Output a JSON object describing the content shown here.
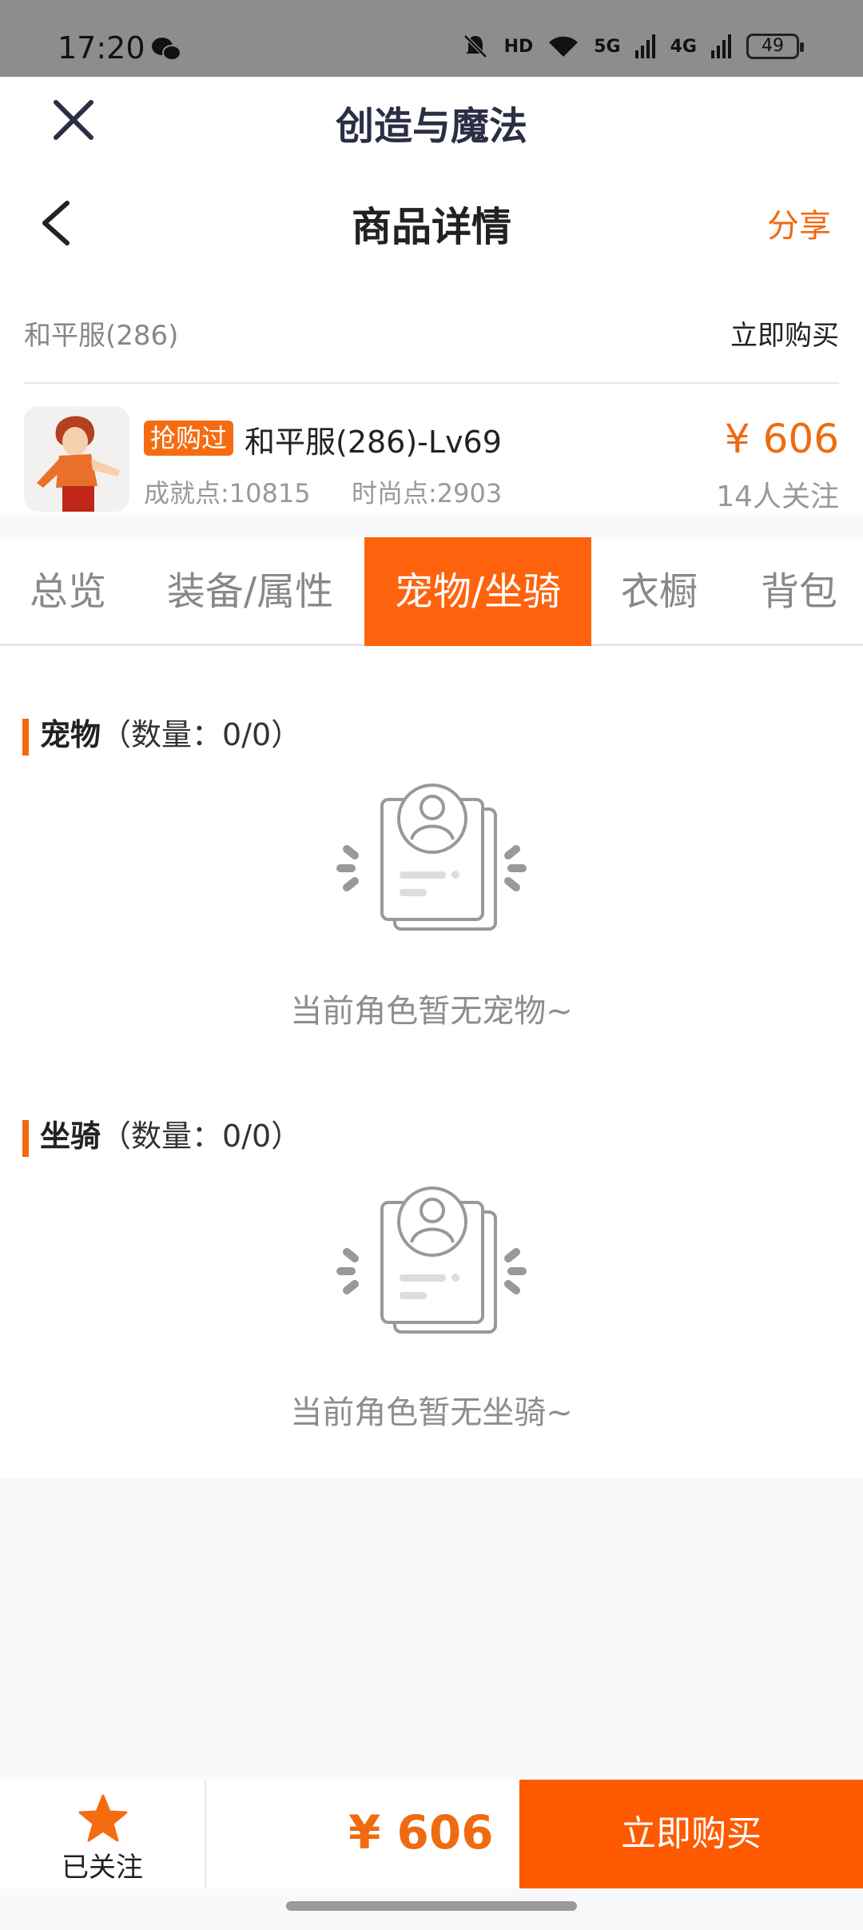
{
  "status_bar": {
    "time": "17:20",
    "network_labels": [
      "HD",
      "5G",
      "4G"
    ],
    "battery": "49"
  },
  "header": {
    "app_title": "创造与魔法"
  },
  "nav": {
    "title": "商品详情",
    "share": "分享"
  },
  "server": {
    "name": "和平服(286)",
    "buy_now": "立即购买"
  },
  "product": {
    "badge": "抢购过",
    "name": "和平服(286)-Lv69",
    "achievement": "成就点:10815",
    "fashion": "时尚点:2903",
    "price": "¥ 606",
    "followers": "14人关注"
  },
  "tabs": [
    "总览",
    "装备/属性",
    "宠物/坐骑",
    "衣橱",
    "背包"
  ],
  "active_tab_index": 2,
  "sections": {
    "pets": {
      "title": "宠物",
      "count": "（数量：0/0）",
      "empty_text": "当前角色暂无宠物~"
    },
    "mounts": {
      "title": "坐骑",
      "count": "（数量：0/0）",
      "empty_text": "当前角色暂无坐骑~"
    }
  },
  "bottom": {
    "follow_label": "已关注",
    "price": "¥ 606",
    "buy_button": "立即购买"
  },
  "colors": {
    "accent": "#ff620d",
    "price": "#f06a10",
    "status_bar": "#8f8d8b"
  }
}
